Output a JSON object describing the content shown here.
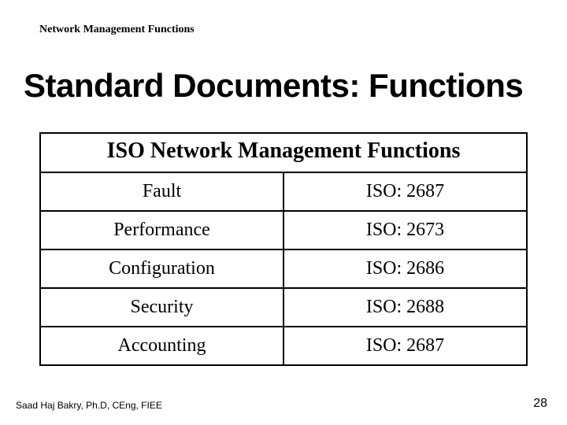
{
  "header": {
    "topic": "Network Management Functions"
  },
  "title": "Standard Documents: Functions",
  "table": {
    "caption": "ISO  Network Management  Functions",
    "rows": [
      {
        "name": "Fault",
        "code": "ISO: 2687"
      },
      {
        "name": "Performance",
        "code": "ISO: 2673"
      },
      {
        "name": "Configuration",
        "code": "ISO: 2686"
      },
      {
        "name": "Security",
        "code": "ISO: 2688"
      },
      {
        "name": "Accounting",
        "code": "ISO: 2687"
      }
    ]
  },
  "footer": {
    "author": "Saad Haj Bakry, Ph.D, CEng, FIEE",
    "page": "28"
  }
}
